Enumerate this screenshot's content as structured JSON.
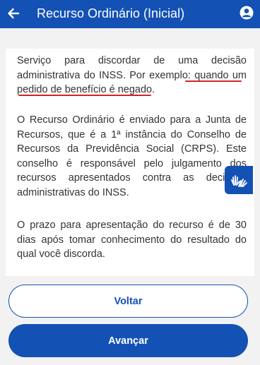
{
  "header": {
    "title": "Recurso Ordinário (Inicial)",
    "back_icon": "arrow-left-icon",
    "user_icon": "user-circle-icon",
    "background": "#1351b4"
  },
  "content": {
    "p1_lead": "Serviço para discordar de uma decisão administrativa do INSS. Por exemplo: ",
    "p1_highlight": "quando um pedido de benefício é negado.",
    "p2": "O Recurso Ordinário é enviado para a Junta de Recursos, que é a 1ª instância do Conselho de Recursos da Previdência Social (CRPS). Este conselho é responsável pelo julgamento dos recursos apresentados contra as decisões administrativas do INSS.",
    "p3": "O prazo para apresentação do recurso é de 30 dias após tomar conhecimento do resultado do qual você discorda.",
    "highlight_color": "#d3222a"
  },
  "accessibility": {
    "icon": "sign-language-hands-icon"
  },
  "footer": {
    "back_label": "Voltar",
    "next_label": "Avançar"
  }
}
